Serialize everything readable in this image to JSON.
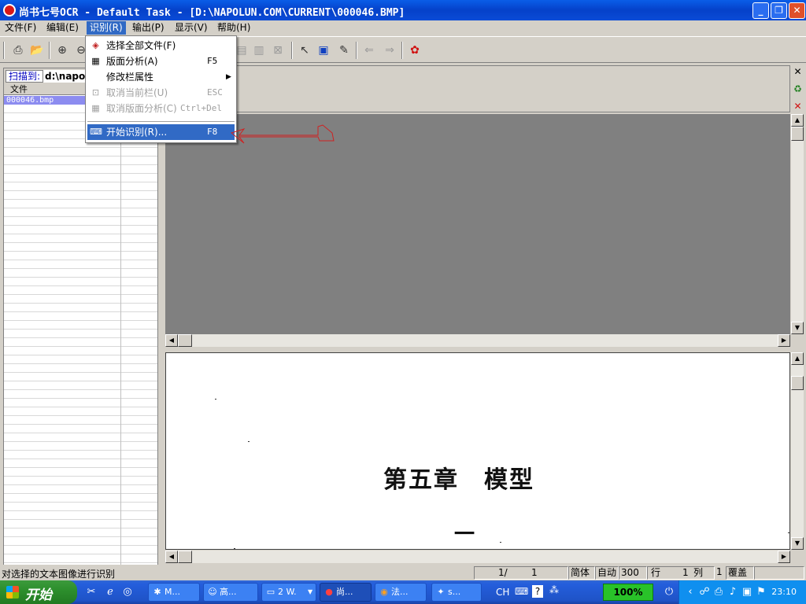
{
  "window": {
    "title": "尚书七号OCR - Default Task - [D:\\NAPOLUN.COM\\CURRENT\\000046.BMP]",
    "minimize": "_",
    "restore": "❐",
    "close": "✕"
  },
  "menubar": {
    "items": [
      {
        "label": "文件(F)"
      },
      {
        "label": "编辑(E)"
      },
      {
        "label": "识别(R)"
      },
      {
        "label": "输出(P)"
      },
      {
        "label": "显示(V)"
      },
      {
        "label": "帮助(H)"
      }
    ]
  },
  "recognize_menu": {
    "items": [
      {
        "label": "选择全部文件(F)",
        "shortcut": "",
        "icon": "select-all-files-icon"
      },
      {
        "label": "版面分析(A)",
        "shortcut": "F5",
        "icon": "layout-analysis-icon"
      },
      {
        "label": "修改栏属性",
        "shortcut": "",
        "icon": ""
      },
      {
        "label": "取消当前栏(U)",
        "shortcut": "ESC",
        "icon": "cancel-column-icon"
      },
      {
        "label": "取消版面分析(C)",
        "shortcut": "Ctrl+Del",
        "icon": "cancel-layout-icon"
      },
      {
        "label": "开始识别(R)...",
        "shortcut": "F8",
        "icon": "start-recognition-icon"
      }
    ]
  },
  "left_panel": {
    "scan_label": "扫描到:",
    "scan_path": "d:\\napolu",
    "column_header": "文件",
    "files": [
      "000046.bmp"
    ]
  },
  "document": {
    "heading": "第五章　模型",
    "line2": "一"
  },
  "statusbar": {
    "message": "对选择的文本图像进行识别",
    "page": "1/",
    "page_total": "1",
    "script": "简体",
    "mode": "自动",
    "dpi": "300",
    "row_label": "行",
    "row_value": "1",
    "col_label": "列",
    "col_value": "1",
    "overwrite": "覆盖"
  },
  "taskbar": {
    "start": "开始",
    "tasks": [
      {
        "label": "M...",
        "icon": "app-icon"
      },
      {
        "label": "高...",
        "icon": "people-icon"
      },
      {
        "label": "2 W.",
        "icon": "folder-icon"
      },
      {
        "label": "尚...",
        "icon": "ocr-icon"
      },
      {
        "label": "法...",
        "icon": "firefox-icon"
      },
      {
        "label": "s...",
        "icon": "tool-icon"
      }
    ],
    "ime": "CH",
    "zoom": "100%",
    "clock": "23:10"
  },
  "colors": {
    "menu_highlight": "#316ac5",
    "titlebar": "#0a4bd6",
    "preview_bg": "#808080",
    "annotation": "#d02020"
  }
}
